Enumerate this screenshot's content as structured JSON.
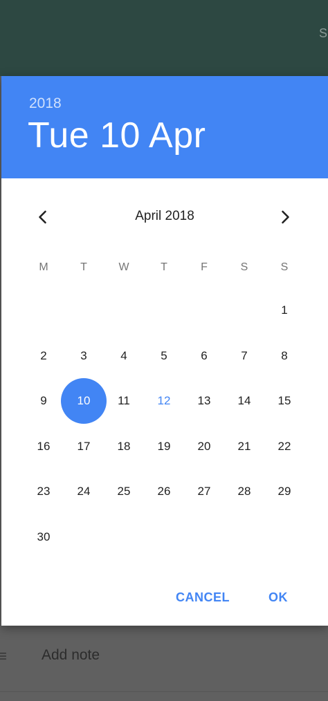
{
  "background": {
    "app_bar_action": "S/",
    "note_placeholder": "Add note"
  },
  "dialog": {
    "header": {
      "year": "2018",
      "date": "Tue 10 Apr"
    },
    "month_label": "April 2018",
    "weekdays": [
      "M",
      "T",
      "W",
      "T",
      "F",
      "S",
      "S"
    ],
    "days": [
      "1",
      "2",
      "3",
      "4",
      "5",
      "6",
      "7",
      "8",
      "9",
      "10",
      "11",
      "12",
      "13",
      "14",
      "15",
      "16",
      "17",
      "18",
      "19",
      "20",
      "21",
      "22",
      "23",
      "24",
      "25",
      "26",
      "27",
      "28",
      "29",
      "30"
    ],
    "selected_day": "10",
    "today_day": "12",
    "actions": {
      "cancel": "CANCEL",
      "ok": "OK"
    },
    "colors": {
      "accent": "#4285f4",
      "app_bar": "#2d4842"
    }
  },
  "icons": {
    "prev": "chevron-left-icon",
    "next": "chevron-right-icon"
  }
}
